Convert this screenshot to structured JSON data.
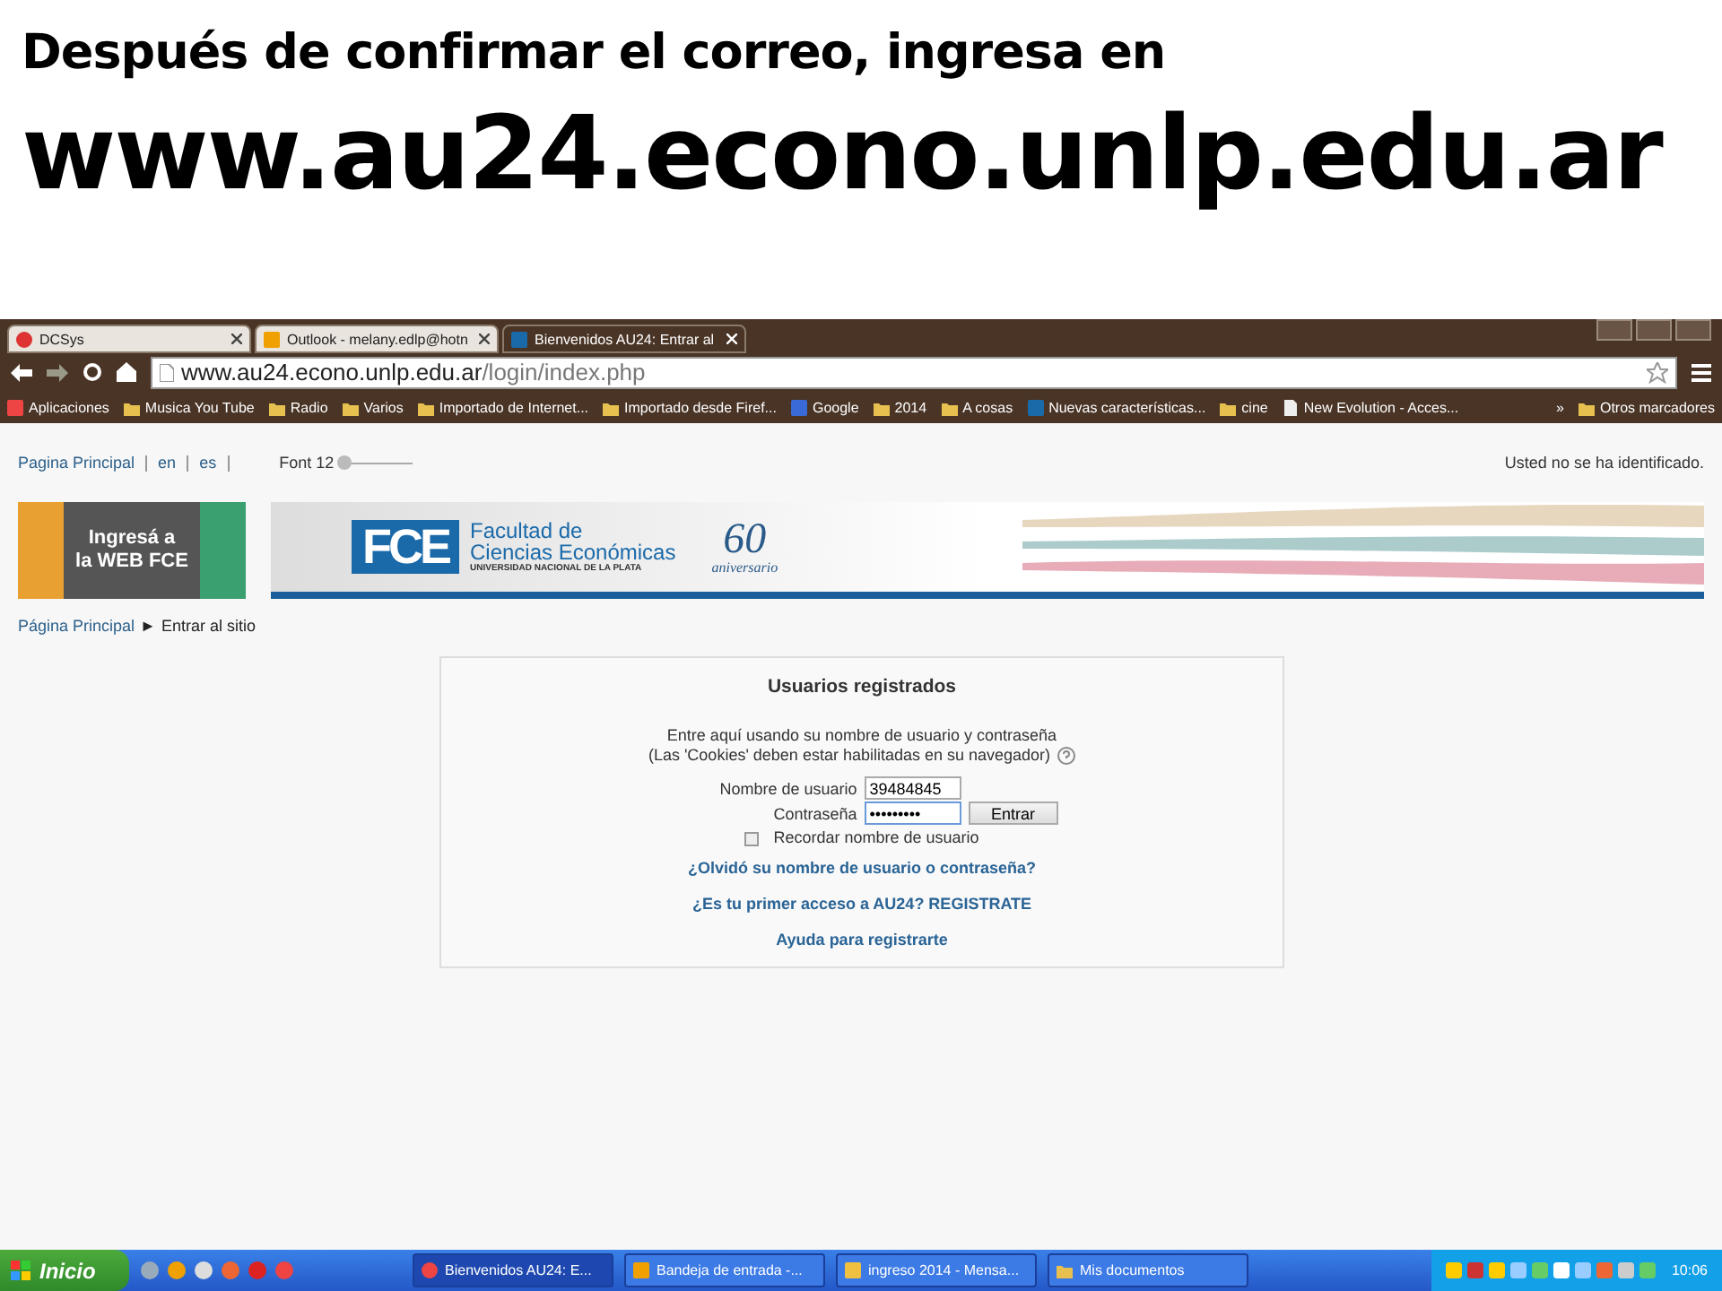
{
  "slide": {
    "line_1": "Después de confirmar el correo, ingresa en",
    "line_2": "www.au24.econo.unlp.edu.ar"
  },
  "browser": {
    "tabs": [
      {
        "label": "DCSys",
        "kind": "red",
        "selected": false
      },
      {
        "label": "Outlook - melany.edlp@hotn",
        "kind": "outlook",
        "selected": false
      },
      {
        "label": "Bienvenidos AU24: Entrar al",
        "kind": "fn",
        "selected": true
      }
    ],
    "address": {
      "host": "www.au24.econo.unlp.edu.ar",
      "path": "/login/index.php"
    },
    "bookmarks": [
      {
        "label": "Aplicaciones",
        "kind": "apps"
      },
      {
        "label": "Musica You Tube",
        "kind": "folder"
      },
      {
        "label": "Radio",
        "kind": "folder"
      },
      {
        "label": "Varios",
        "kind": "folder"
      },
      {
        "label": "Importado de Internet...",
        "kind": "folder"
      },
      {
        "label": "Importado desde Firef...",
        "kind": "folder"
      },
      {
        "label": "Google",
        "kind": "google"
      },
      {
        "label": "2014",
        "kind": "folder"
      },
      {
        "label": "A cosas",
        "kind": "folder"
      },
      {
        "label": "Nuevas características...",
        "kind": "fn"
      },
      {
        "label": "cine",
        "kind": "folder"
      },
      {
        "label": "New Evolution - Acces...",
        "kind": "page"
      }
    ],
    "bookmarks_more": "»",
    "other_bookmarks": "Otros marcadores"
  },
  "page": {
    "top_links": [
      "Pagina Principal",
      "en",
      "es"
    ],
    "font": {
      "label": "Font 12",
      "level": 0.05
    },
    "login_status": "Usted no se ha identificado.",
    "promo": {
      "line_1": "Ingresá a",
      "line_2": "la WEB FCE"
    },
    "banner": {
      "logo": "FCE",
      "name_1": "Facultad de",
      "name_2": "Ciencias Económicas",
      "university": "UNIVERSIDAD NACIONAL DE LA PLATA",
      "anniversary_number": "60",
      "anniversary_word": "aniversario"
    },
    "breadcrumb": {
      "home": "Página Principal",
      "separator": "►",
      "current": "Entrar al sitio"
    },
    "login": {
      "title": "Usuarios registrados",
      "intro_1": "Entre aquí usando su nombre de usuario y contraseña",
      "intro_2": "(Las 'Cookies' deben estar habilitadas en su navegador)",
      "username_label": "Nombre de usuario",
      "username_value": "39484845",
      "password_label": "Contraseña",
      "password_value": "•••••••••",
      "submit": "Entrar",
      "remember": {
        "label": "Recordar nombre de usuario",
        "checked": false
      },
      "links": [
        "¿Olvidó su nombre de usuario o contraseña?",
        "¿Es tu primer acceso a AU24? REGISTRATE",
        "Ayuda para registrarte"
      ]
    }
  },
  "taskbar": {
    "start": "Inicio",
    "windows": [
      {
        "label": "Bienvenidos AU24: E...",
        "kind": "chrome",
        "selected": true
      },
      {
        "label": "Bandeja de entrada -...",
        "kind": "outlook",
        "selected": false
      },
      {
        "label": "ingreso 2014 - Mensa...",
        "kind": "mail",
        "selected": false
      },
      {
        "label": "Mis documentos",
        "kind": "folder",
        "selected": false
      }
    ],
    "clock": "10:06"
  }
}
